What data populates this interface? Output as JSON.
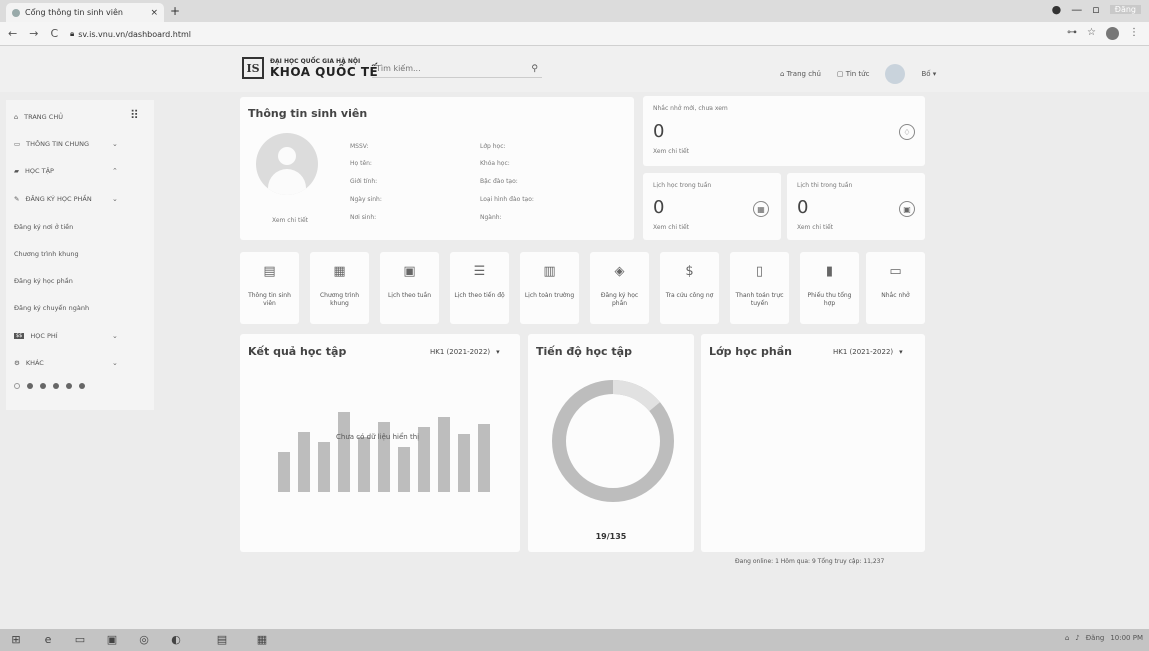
{
  "browser": {
    "tab_title": "Cổng thông tin sinh viên",
    "tab_close": "×",
    "new_tab": "+",
    "url": "sv.is.vnu.vn/dashboard.html",
    "win_controls": [
      "—",
      "▫",
      "Đăng"
    ]
  },
  "header": {
    "logo_mark": "IS",
    "logo_line1": "ĐẠI HỌC QUỐC GIA HÀ NỘI",
    "logo_line2": "KHOA QUỐC TẾ",
    "search_placeholder": "Tìm kiếm...",
    "nav_home": "Trang chủ",
    "nav_news": "Tin tức",
    "user_name": "Bố"
  },
  "sidebar": {
    "items": [
      {
        "label": "TRANG CHỦ",
        "icon": "home-icon"
      },
      {
        "label": "THÔNG TIN CHUNG",
        "icon": "monitor-icon"
      },
      {
        "label": "HỌC TẬP",
        "icon": "graduation-cap-icon"
      },
      {
        "label": "ĐĂNG KÝ HỌC PHẦN",
        "icon": "edit-icon"
      }
    ],
    "sub_items": [
      "Đăng ký nơi ở tiền",
      "Chương trình khung",
      "Đăng ký học phần",
      "Đăng ký chuyển ngành"
    ],
    "items2": [
      {
        "label": "HỌC PHÍ",
        "icon": "money-icon"
      },
      {
        "label": "KHÁC",
        "icon": "gear-icon"
      }
    ]
  },
  "student_info": {
    "title": "Thông tin sinh viên",
    "view_detail": "Xem chi tiết",
    "left_labels": [
      "MSSV:",
      "Họ tên:",
      "Giới tính:",
      "Ngày sinh:",
      "Nơi sinh:"
    ],
    "right_labels": [
      "Lớp học:",
      "Khóa học:",
      "Bậc đào tạo:",
      "Loại hình đào tạo:",
      "Ngành:"
    ]
  },
  "stats": {
    "reminders": {
      "label": "Nhắc nhở mới, chưa xem",
      "value": "0",
      "link": "Xem chi tiết"
    },
    "week_schedule": {
      "label": "Lịch học trong tuần",
      "value": "0",
      "link": "Xem chi tiết"
    },
    "exam_schedule": {
      "label": "Lịch thi trong tuần",
      "value": "0",
      "link": "Xem chi tiết"
    }
  },
  "tiles": [
    {
      "label": "Thông tin sinh viên",
      "icon": "id-card-icon"
    },
    {
      "label": "Chương trình khung",
      "icon": "grid-icon"
    },
    {
      "label": "Lịch theo tuần",
      "icon": "calendar-icon"
    },
    {
      "label": "Lịch theo tiến độ",
      "icon": "list-icon"
    },
    {
      "label": "Lịch toàn trường",
      "icon": "columns-icon"
    },
    {
      "label": "Đăng ký học phần",
      "icon": "layers-icon"
    },
    {
      "label": "Tra cứu công nợ",
      "icon": "dollar-icon"
    },
    {
      "label": "Thanh toán trực tuyến",
      "icon": "invoice-icon"
    },
    {
      "label": "Phiếu thu tổng hợp",
      "icon": "receipt-icon"
    },
    {
      "label": "Nhắc nhở",
      "icon": "inbox-icon"
    }
  ],
  "results": {
    "title": "Kết quả học tập",
    "term": "HK1 (2021-2022)",
    "empty": "Chưa có dữ liệu hiển thị"
  },
  "progress": {
    "title": "Tiến độ học tập",
    "value": "19/135",
    "fraction": 0.14
  },
  "classes": {
    "title": "Lớp học phần",
    "term": "HK1 (2021-2022)"
  },
  "footer": {
    "text": "Đang online: 1  Hôm qua: 9  Tổng truy cập: 11,237"
  },
  "tray": [
    "Đăng",
    "10:00 PM"
  ]
}
